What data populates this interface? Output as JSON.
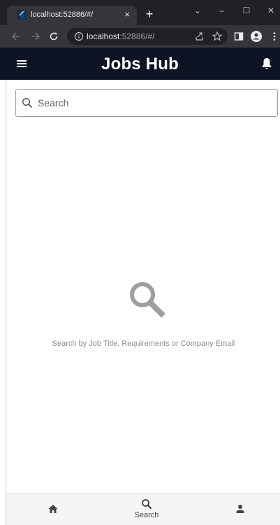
{
  "browser": {
    "tab_title": "localhost:52886/#/",
    "tab_close": "×",
    "new_tab": "+",
    "url_host": "localhost",
    "url_rest": ":52886/#/",
    "icons": [
      "back-icon",
      "forward-icon",
      "reload-icon",
      "info-icon",
      "share-icon",
      "star-icon",
      "side-panel-icon",
      "profile-icon",
      "more-icon"
    ]
  },
  "window_controls": {
    "chevron": "⌄",
    "minimize": "–",
    "maximize": "☐",
    "close": "✕"
  },
  "app": {
    "title": "Jobs Hub",
    "header_bg": "#0f1424",
    "icons": [
      "menu-icon",
      "bell-icon"
    ]
  },
  "search": {
    "placeholder": "Search",
    "value": ""
  },
  "empty_state": {
    "icon": "search-icon",
    "message": "Search by Job Title, Requirements or Company Email"
  },
  "bottom_nav": {
    "items": [
      {
        "icon": "home-icon",
        "label": ""
      },
      {
        "icon": "search-icon",
        "label": "Search"
      },
      {
        "icon": "person-icon",
        "label": ""
      }
    ]
  }
}
